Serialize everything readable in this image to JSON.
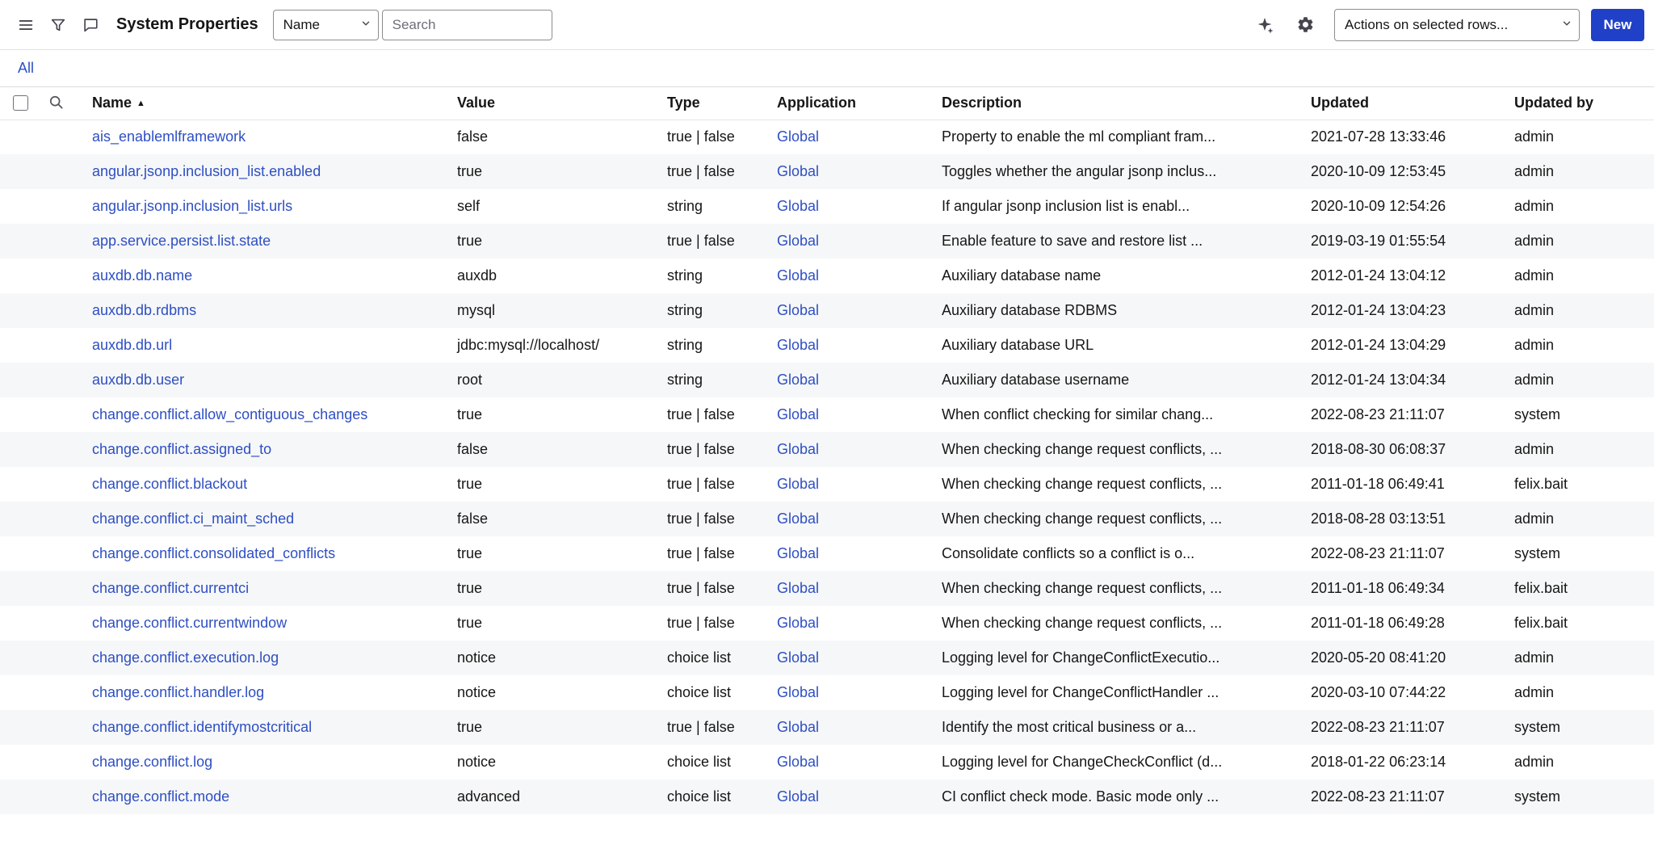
{
  "colors": {
    "link": "#2e4fc3",
    "primary": "#2040c8",
    "zebra": "#f6f7f8",
    "control_border": "#8d8d8d"
  },
  "top_bar": {
    "title": "System Properties",
    "field_selector": {
      "value": "Name"
    },
    "search": {
      "placeholder": "Search"
    },
    "actions_dropdown": {
      "value": "Actions on selected rows..."
    },
    "new_button_label": "New"
  },
  "breadcrumb": {
    "all_label": "All"
  },
  "glyphs": {
    "sort_asc": "▲"
  },
  "table": {
    "sort": {
      "column": "Name",
      "direction": "ascending"
    },
    "columns": [
      {
        "key": "name",
        "label": "Name"
      },
      {
        "key": "value",
        "label": "Value"
      },
      {
        "key": "type",
        "label": "Type"
      },
      {
        "key": "application",
        "label": "Application"
      },
      {
        "key": "description",
        "label": "Description"
      },
      {
        "key": "updated",
        "label": "Updated"
      },
      {
        "key": "updated_by",
        "label": "Updated by"
      }
    ],
    "rows": [
      {
        "name": "ais_enablemlframework",
        "value": "false",
        "type": "true | false",
        "application": "Global",
        "description": "Property to enable the ml compliant fram...",
        "updated": "2021-07-28 13:33:46",
        "updated_by": "admin"
      },
      {
        "name": "angular.jsonp.inclusion_list.enabled",
        "value": "true",
        "type": "true | false",
        "application": "Global",
        "description": "Toggles whether the angular jsonp inclus...",
        "updated": "2020-10-09 12:53:45",
        "updated_by": "admin"
      },
      {
        "name": "angular.jsonp.inclusion_list.urls",
        "value": "self",
        "type": "string",
        "application": "Global",
        "description": "If angular jsonp inclusion list is enabl...",
        "updated": "2020-10-09 12:54:26",
        "updated_by": "admin"
      },
      {
        "name": "app.service.persist.list.state",
        "value": "true",
        "type": "true | false",
        "application": "Global",
        "description": "Enable feature to save and restore list ...",
        "updated": "2019-03-19 01:55:54",
        "updated_by": "admin"
      },
      {
        "name": "auxdb.db.name",
        "value": "auxdb",
        "type": "string",
        "application": "Global",
        "description": "Auxiliary database name",
        "updated": "2012-01-24 13:04:12",
        "updated_by": "admin"
      },
      {
        "name": "auxdb.db.rdbms",
        "value": "mysql",
        "type": "string",
        "application": "Global",
        "description": "Auxiliary database RDBMS",
        "updated": "2012-01-24 13:04:23",
        "updated_by": "admin"
      },
      {
        "name": "auxdb.db.url",
        "value": "jdbc:mysql://localhost/",
        "type": "string",
        "application": "Global",
        "description": "Auxiliary database URL",
        "updated": "2012-01-24 13:04:29",
        "updated_by": "admin"
      },
      {
        "name": "auxdb.db.user",
        "value": "root",
        "type": "string",
        "application": "Global",
        "description": "Auxiliary database username",
        "updated": "2012-01-24 13:04:34",
        "updated_by": "admin"
      },
      {
        "name": "change.conflict.allow_contiguous_changes",
        "value": "true",
        "type": "true | false",
        "application": "Global",
        "description": "When conflict checking for similar chang...",
        "updated": "2022-08-23 21:11:07",
        "updated_by": "system"
      },
      {
        "name": "change.conflict.assigned_to",
        "value": "false",
        "type": "true | false",
        "application": "Global",
        "description": "When checking change request conflicts, ...",
        "updated": "2018-08-30 06:08:37",
        "updated_by": "admin"
      },
      {
        "name": "change.conflict.blackout",
        "value": "true",
        "type": "true | false",
        "application": "Global",
        "description": "When checking change request conflicts, ...",
        "updated": "2011-01-18 06:49:41",
        "updated_by": "felix.bait"
      },
      {
        "name": "change.conflict.ci_maint_sched",
        "value": "false",
        "type": "true | false",
        "application": "Global",
        "description": "When checking change request conflicts, ...",
        "updated": "2018-08-28 03:13:51",
        "updated_by": "admin"
      },
      {
        "name": "change.conflict.consolidated_conflicts",
        "value": "true",
        "type": "true | false",
        "application": "Global",
        "description": "Consolidate conflicts so a conflict is o...",
        "updated": "2022-08-23 21:11:07",
        "updated_by": "system"
      },
      {
        "name": "change.conflict.currentci",
        "value": "true",
        "type": "true | false",
        "application": "Global",
        "description": "When checking change request conflicts, ...",
        "updated": "2011-01-18 06:49:34",
        "updated_by": "felix.bait"
      },
      {
        "name": "change.conflict.currentwindow",
        "value": "true",
        "type": "true | false",
        "application": "Global",
        "description": "When checking change request conflicts, ...",
        "updated": "2011-01-18 06:49:28",
        "updated_by": "felix.bait"
      },
      {
        "name": "change.conflict.execution.log",
        "value": "notice",
        "type": "choice list",
        "application": "Global",
        "description": "Logging level for ChangeConflictExecutio...",
        "updated": "2020-05-20 08:41:20",
        "updated_by": "admin"
      },
      {
        "name": "change.conflict.handler.log",
        "value": "notice",
        "type": "choice list",
        "application": "Global",
        "description": "Logging level for ChangeConflictHandler ...",
        "updated": "2020-03-10 07:44:22",
        "updated_by": "admin"
      },
      {
        "name": "change.conflict.identifymostcritical",
        "value": "true",
        "type": "true | false",
        "application": "Global",
        "description": "Identify the most critical business or a...",
        "updated": "2022-08-23 21:11:07",
        "updated_by": "system"
      },
      {
        "name": "change.conflict.log",
        "value": "notice",
        "type": "choice list",
        "application": "Global",
        "description": "Logging level for ChangeCheckConflict (d...",
        "updated": "2018-01-22 06:23:14",
        "updated_by": "admin"
      },
      {
        "name": "change.conflict.mode",
        "value": "advanced",
        "type": "choice list",
        "application": "Global",
        "description": "CI conflict check mode. Basic mode only ...",
        "updated": "2022-08-23 21:11:07",
        "updated_by": "system"
      }
    ]
  }
}
